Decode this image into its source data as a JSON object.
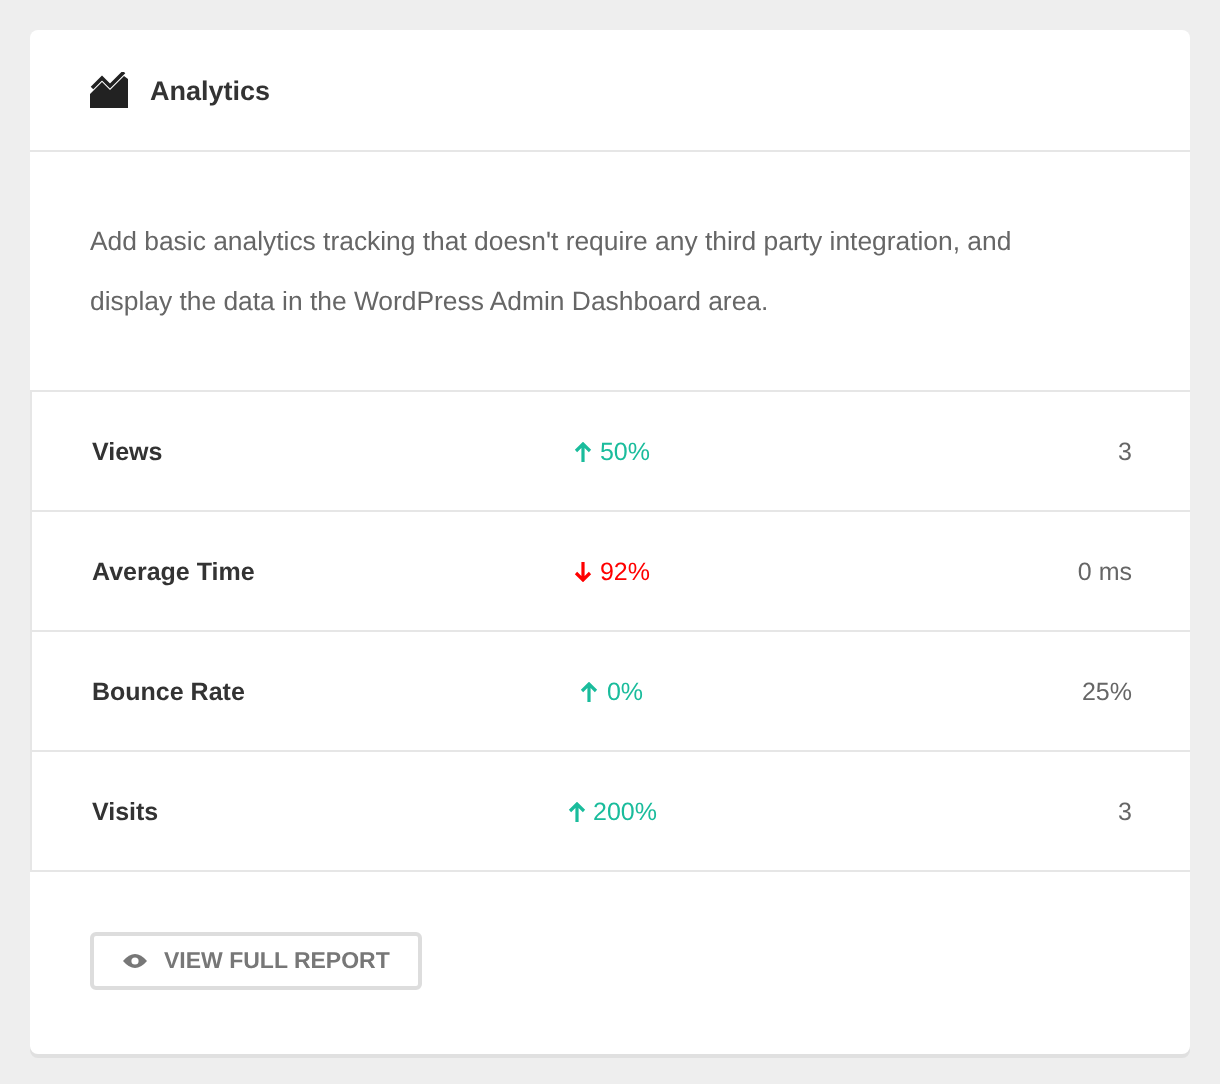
{
  "card": {
    "title": "Analytics",
    "description": "Add basic analytics tracking that doesn't require any third party integration, and display the data in the WordPress Admin Dashboard area."
  },
  "metrics": [
    {
      "name": "Views",
      "kind": "up",
      "change": "50%",
      "value": "3"
    },
    {
      "name": "Average Time",
      "kind": "down",
      "change": "92%",
      "value": "0 ms"
    },
    {
      "name": "Bounce Rate",
      "kind": "up",
      "change": "0%",
      "value": "25%"
    },
    {
      "name": "Visits",
      "kind": "up",
      "change": "200%",
      "value": "3"
    }
  ],
  "button": {
    "label": "VIEW FULL REPORT"
  }
}
